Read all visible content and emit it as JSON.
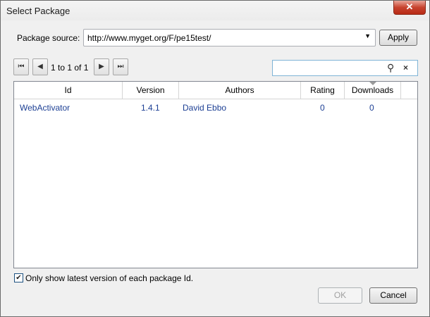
{
  "window": {
    "title": "Select Package",
    "close_symbol": "✕"
  },
  "source": {
    "label": "Package source:",
    "value": "http://www.myget.org/F/pe15test/",
    "dropdown_arrow": "▼",
    "apply_label": "Apply"
  },
  "pager": {
    "first_symbol": "⏮",
    "prev_symbol": "◀",
    "text": "1 to 1 of 1",
    "next_symbol": "▶",
    "last_symbol": "⏭"
  },
  "search": {
    "value": "",
    "icon": "⚲",
    "clear_symbol": "×"
  },
  "grid": {
    "columns": [
      "Id",
      "Version",
      "Authors",
      "Rating",
      "Downloads"
    ],
    "sorted_column": "Downloads",
    "rows": [
      {
        "id": "WebActivator",
        "version": "1.4.1",
        "authors": "David Ebbo",
        "rating": "0",
        "downloads": "0"
      }
    ]
  },
  "options": {
    "latest_only_label": "Only show latest version of each package Id.",
    "latest_only_checked": true,
    "check_symbol": "✔"
  },
  "buttons": {
    "ok_label": "OK",
    "ok_enabled": false,
    "cancel_label": "Cancel"
  }
}
